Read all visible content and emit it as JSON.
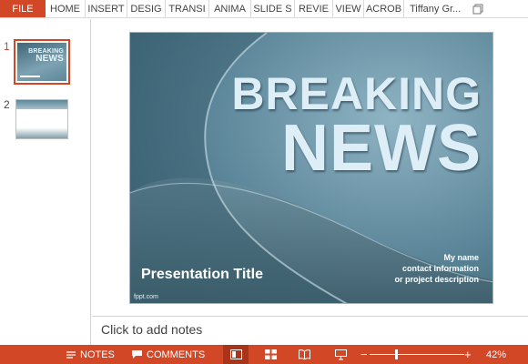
{
  "ribbon": {
    "file_label": "FILE",
    "tabs": [
      {
        "label": "HOME",
        "w": 44
      },
      {
        "label": "INSERT",
        "w": 46
      },
      {
        "label": "DESIG",
        "w": 42
      },
      {
        "label": "TRANSI",
        "w": 48
      },
      {
        "label": "ANIMA",
        "w": 46
      },
      {
        "label": "SLIDE S",
        "w": 48
      },
      {
        "label": "REVIE",
        "w": 42
      },
      {
        "label": "VIEW",
        "w": 34
      },
      {
        "label": "ACROB",
        "w": 44
      }
    ],
    "user_name": "Tiffany Gr...",
    "restore_icon": "restore-icon"
  },
  "thumbnails": {
    "items": [
      {
        "number": "1",
        "title_line1": "BREAKING",
        "title_line2": "NEWS",
        "selected": true
      },
      {
        "number": "2",
        "selected": false
      }
    ]
  },
  "slide": {
    "headline_line1": "BREAKING",
    "headline_line2": "NEWS",
    "title": "Presentation Title",
    "contact_line1": "My name",
    "contact_line2": "contact information",
    "contact_line3": "or project description",
    "watermark": "fppt.com"
  },
  "notes": {
    "placeholder": "Click to add notes"
  },
  "status_bar": {
    "notes_label": "NOTES",
    "comments_label": "COMMENTS",
    "zoom_level": "42%",
    "zoom_fraction": 0.28,
    "views": [
      "normal-view-icon",
      "slide-sorter-icon",
      "reading-view-icon",
      "slideshow-icon"
    ],
    "active_view": "normal-view-icon"
  },
  "colors": {
    "accent": "#d24726",
    "slide_bg": "#5a8497"
  }
}
